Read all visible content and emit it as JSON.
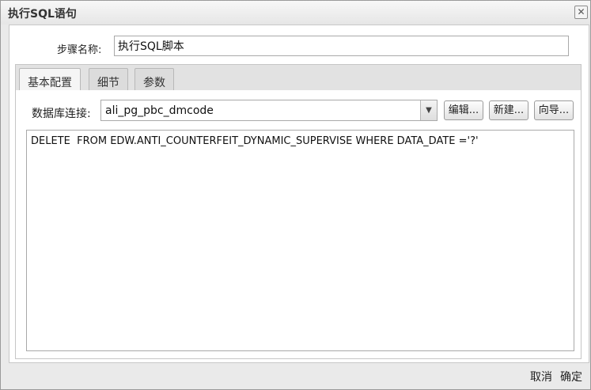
{
  "dialog": {
    "title": "执行SQL语句",
    "close_glyph": "✕"
  },
  "step": {
    "label": "步骤名称:",
    "value": "执行SQL脚本"
  },
  "tabs": [
    {
      "label": "基本配置",
      "active": true
    },
    {
      "label": "细节",
      "active": false
    },
    {
      "label": "参数",
      "active": false
    }
  ],
  "db": {
    "label": "数据库连接:",
    "value": "ali_pg_pbc_dmcode",
    "edit_label": "编辑...",
    "new_label": "新建...",
    "wizard_label": "向导..."
  },
  "sql": {
    "text": "DELETE  FROM EDW.ANTI_COUNTERFEIT_DYNAMIC_SUPERVISE WHERE DATA_DATE ='?'"
  },
  "footer": {
    "cancel_label": "取消",
    "ok_label": "确定"
  }
}
